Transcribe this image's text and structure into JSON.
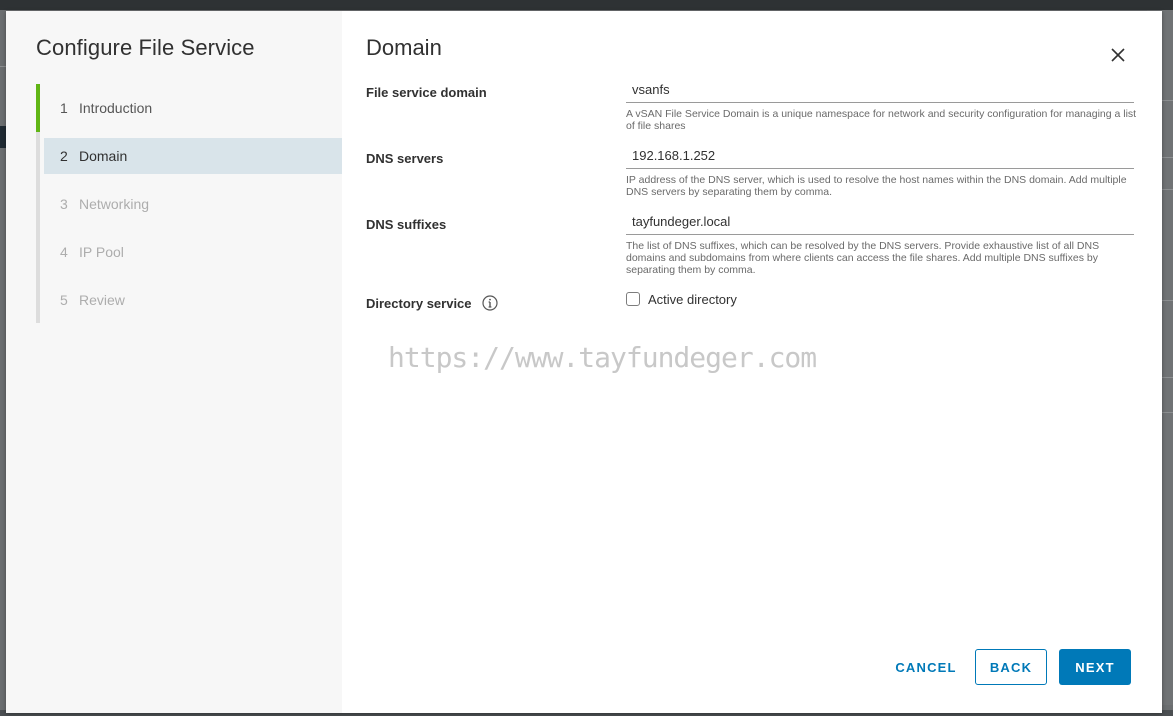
{
  "wizard": {
    "title": "Configure File Service",
    "steps": [
      {
        "num": "1",
        "label": "Introduction",
        "state": "done"
      },
      {
        "num": "2",
        "label": "Domain",
        "state": "active"
      },
      {
        "num": "3",
        "label": "Networking",
        "state": "disabled"
      },
      {
        "num": "4",
        "label": "IP Pool",
        "state": "disabled"
      },
      {
        "num": "5",
        "label": "Review",
        "state": "disabled"
      }
    ]
  },
  "page": {
    "title": "Domain",
    "close_icon": "close-icon"
  },
  "form": {
    "file_service_domain": {
      "label": "File service domain",
      "value": "vsanfs",
      "help": "A vSAN File Service Domain is a unique namespace for network and security configuration for managing a list of file shares"
    },
    "dns_servers": {
      "label": "DNS servers",
      "value": "192.168.1.252",
      "help": "IP address of the DNS server, which is used to resolve the host names within the DNS domain. Add multiple DNS servers by separating them by comma."
    },
    "dns_suffixes": {
      "label": "DNS suffixes",
      "value": "tayfundeger.local",
      "help": "The list of DNS suffixes, which can be resolved by the DNS servers. Provide exhaustive list of all DNS domains and subdomains from where clients can access the file shares. Add multiple DNS suffixes by separating them by comma."
    },
    "directory_service": {
      "label": "Directory service",
      "checkbox_label": "Active directory",
      "checked": false
    }
  },
  "watermark": "https://www.tayfundeger.com",
  "footer": {
    "cancel": "CANCEL",
    "back": "BACK",
    "next": "NEXT"
  },
  "colors": {
    "accent": "#0079b8",
    "step_done": "#60b515",
    "step_active_bg": "#d9e4ea"
  }
}
